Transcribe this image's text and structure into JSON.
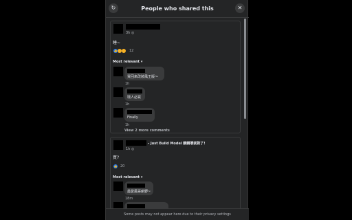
{
  "dialog": {
    "title": "People who shared this",
    "refresh_icon": "refresh-icon",
    "close_icon": "close-icon"
  },
  "posts": [
    {
      "time": "3h",
      "privacy_icon": "globe-icon",
      "text": "睡~",
      "reactions": [
        "like",
        "haha",
        "wow"
      ],
      "reaction_count": "12",
      "sort_label": "Most relevant",
      "comments": [
        {
          "text": "買回來改裝風王版～",
          "time": "1h"
        },
        {
          "text": "壞人必買",
          "time": "1h"
        },
        {
          "text": "Finally",
          "time": "1h"
        }
      ],
      "view_more": "View 2 more comments"
    },
    {
      "time": "1h",
      "privacy_icon": "globe-icon",
      "header_suffix": "- Just Build Model 鋼鋼壞就對了!",
      "text": "買?",
      "reactions": [
        "like"
      ],
      "reaction_count": "20",
      "sort_label": "Most relevant",
      "comments": [
        {
          "text": "最愛風哥啲野~",
          "time": "18m"
        }
      ]
    }
  ],
  "footer": {
    "note": "Some posts may not appear here due to their privacy settings"
  },
  "colors": {
    "background": "#242526",
    "bubble": "#3a3b3c",
    "text": "#e4e6eb",
    "muted": "#b0b3b8",
    "like": "#2078f4",
    "haha": "#f7b125"
  }
}
